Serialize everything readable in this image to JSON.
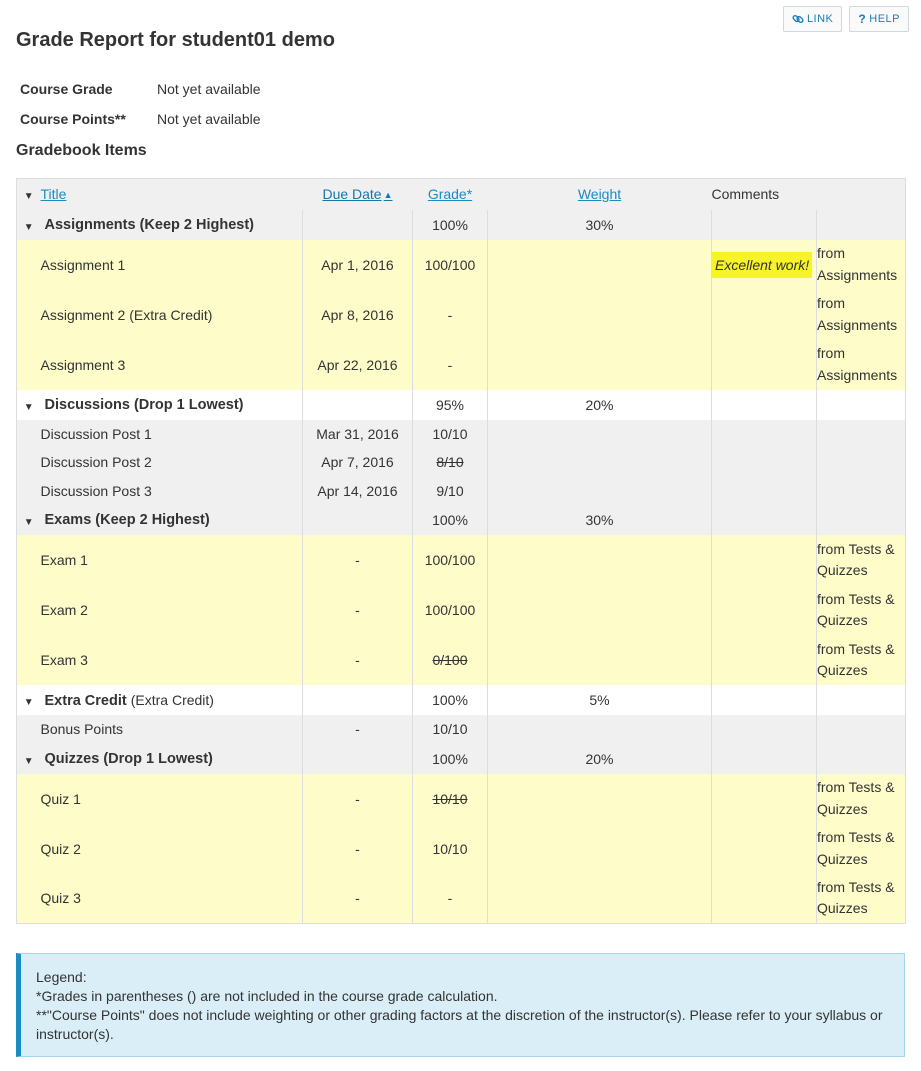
{
  "toolbar": {
    "link_label": "LINK",
    "help_label": "HELP"
  },
  "page_title": "Grade Report for student01 demo",
  "summary": {
    "course_grade_label": "Course Grade",
    "course_grade_value": "Not yet available",
    "course_points_label": "Course Points**",
    "course_points_value": "Not yet available"
  },
  "section_title": "Gradebook Items",
  "table": {
    "headers": {
      "title": "Title",
      "due_date": "Due Date",
      "grade": "Grade*",
      "weight": "Weight",
      "comments": "Comments"
    },
    "categories": [
      {
        "name": "Assignments (Keep 2 Highest)",
        "sub": "",
        "grade": "100%",
        "weight": "30%",
        "items": [
          {
            "title": "Assignment 1",
            "due": "Apr 1, 2016",
            "grade": "100/100",
            "comment": "Excellent work!",
            "source": "from Assignments"
          },
          {
            "title": "Assignment 2 (Extra Credit)",
            "due": "Apr 8, 2016",
            "grade": "-",
            "comment": "",
            "source": "from Assignments"
          },
          {
            "title": "Assignment 3",
            "due": "Apr 22, 2016",
            "grade": "-",
            "comment": "",
            "source": "from Assignments"
          }
        ]
      },
      {
        "name": "Discussions (Drop 1 Lowest)",
        "sub": "",
        "grade": "95%",
        "weight": "20%",
        "items": [
          {
            "title": "Discussion Post 1",
            "due": "Mar 31, 2016",
            "grade": "10/10",
            "dropped": false,
            "source": ""
          },
          {
            "title": "Discussion Post 2",
            "due": "Apr 7, 2016",
            "grade": "8/10",
            "dropped": true,
            "source": ""
          },
          {
            "title": "Discussion Post 3",
            "due": "Apr 14, 2016",
            "grade": "9/10",
            "dropped": false,
            "source": ""
          }
        ]
      },
      {
        "name": "Exams (Keep 2 Highest)",
        "sub": "",
        "grade": "100%",
        "weight": "30%",
        "items": [
          {
            "title": "Exam 1",
            "due": "-",
            "grade": "100/100",
            "dropped": false,
            "source": "from Tests & Quizzes"
          },
          {
            "title": "Exam 2",
            "due": "-",
            "grade": "100/100",
            "dropped": false,
            "source": "from Tests & Quizzes"
          },
          {
            "title": "Exam 3",
            "due": "-",
            "grade": "0/100",
            "dropped": true,
            "source": "from Tests & Quizzes"
          }
        ]
      },
      {
        "name": "Extra Credit",
        "sub": "(Extra Credit)",
        "grade": "100%",
        "weight": "5%",
        "items": [
          {
            "title": "Bonus Points",
            "due": "-",
            "grade": "10/10",
            "dropped": false,
            "source": ""
          }
        ]
      },
      {
        "name": "Quizzes (Drop 1 Lowest)",
        "sub": "",
        "grade": "100%",
        "weight": "20%",
        "items": [
          {
            "title": "Quiz 1",
            "due": "-",
            "grade": "10/10",
            "dropped": true,
            "source": "from Tests & Quizzes"
          },
          {
            "title": "Quiz 2",
            "due": "-",
            "grade": "10/10",
            "dropped": false,
            "source": "from Tests & Quizzes"
          },
          {
            "title": "Quiz 3",
            "due": "-",
            "grade": "-",
            "dropped": false,
            "source": "from Tests & Quizzes"
          }
        ]
      }
    ]
  },
  "legend": {
    "title": "Legend:",
    "line1": "*Grades in parentheses () are not included in the course grade calculation.",
    "line2": "**\"Course Points\" does not include weighting or other grading factors at the discretion of the instructor(s). Please refer to your syllabus or instructor(s)."
  },
  "colors": {
    "link": "#1b8bc4",
    "highlight_row": "#fefdca",
    "comment_highlight": "#f6f329",
    "legend_bg": "#d9eef7"
  }
}
